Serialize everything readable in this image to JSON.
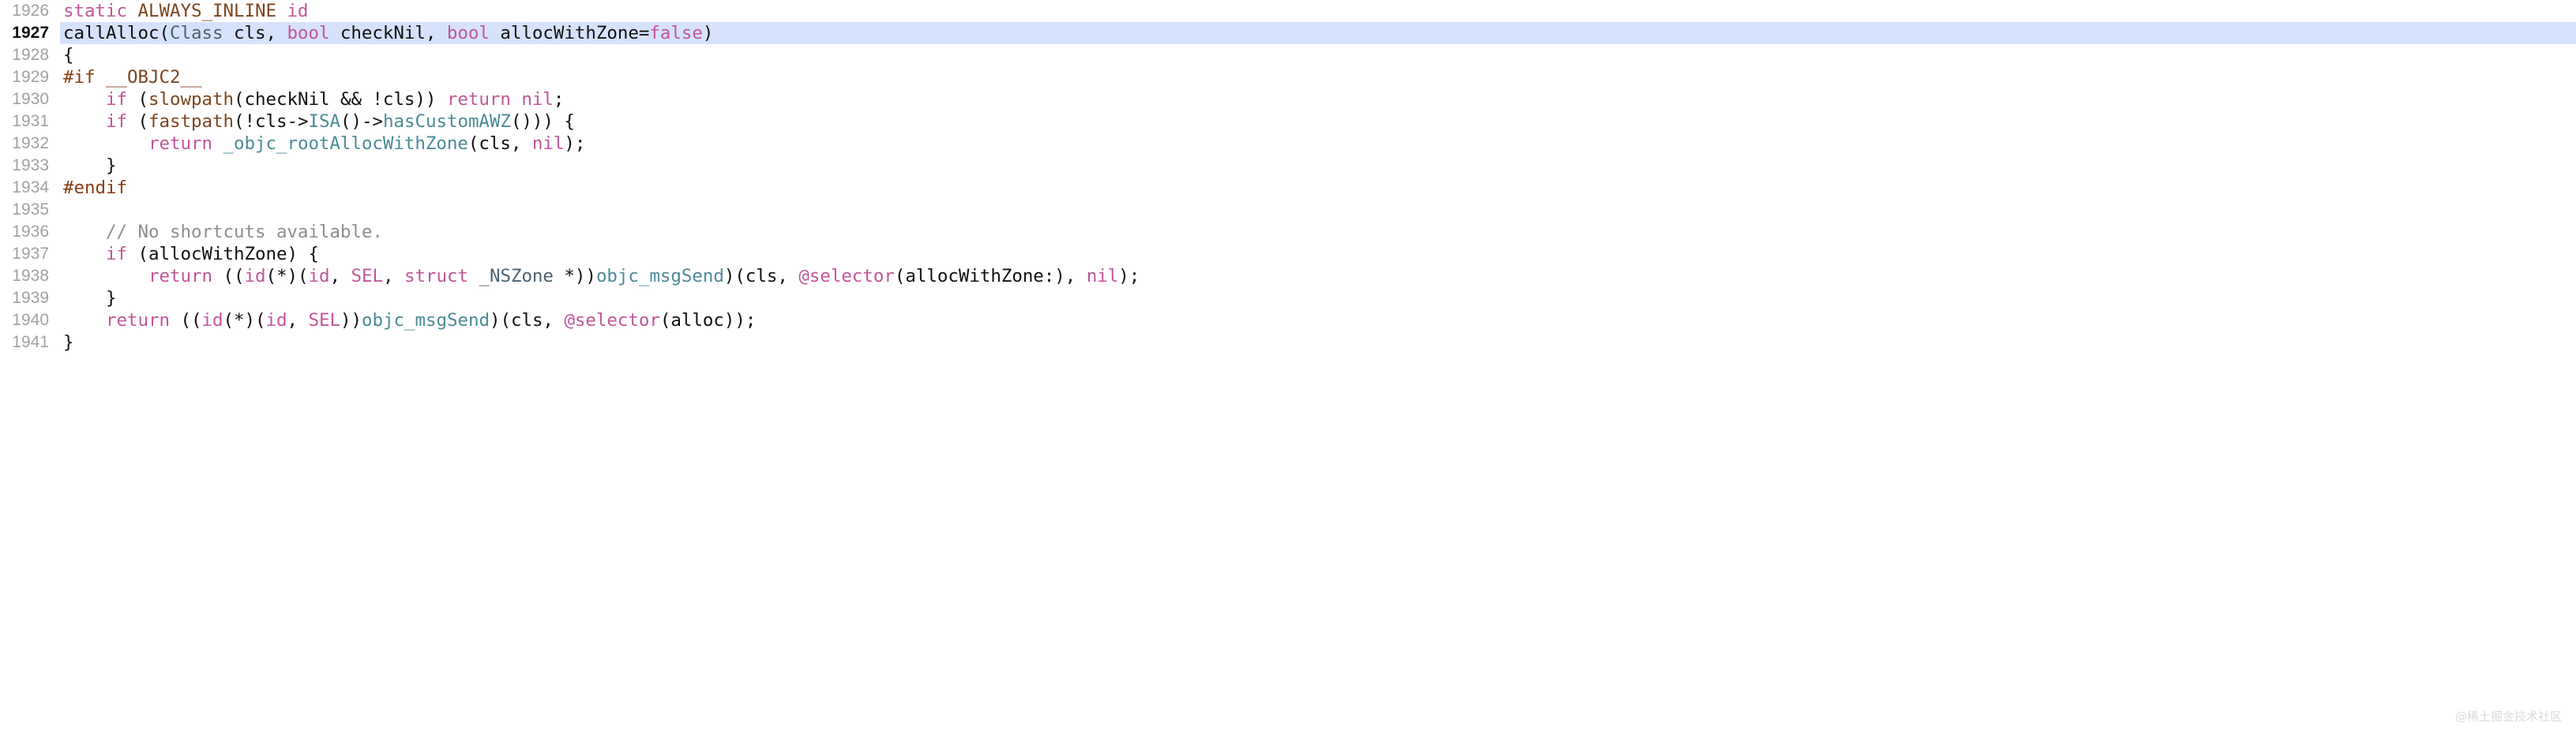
{
  "editor": {
    "background": "#ffffff",
    "gutter_color": "#a2a2a2",
    "highlight_color": "#d6e2fb",
    "highlighted_line": "1927",
    "language": "objective-c",
    "first_line": "1926",
    "last_line": "1941"
  },
  "colors": {
    "plain": "#111111",
    "keyword": "#c2569a",
    "macro": "#7c4521",
    "preproc": "#8a3b14",
    "type": "#4c6270",
    "function": "#3f84b5",
    "member": "#4b8b96",
    "comment": "#8e8e8e"
  },
  "watermark": {
    "text": "@稀土掘金技术社区"
  },
  "lines": [
    {
      "number": "1926",
      "highlighted": false,
      "text": "static ALWAYS_INLINE id",
      "tokens": [
        {
          "t": "static",
          "c": "keyword"
        },
        {
          "t": " ",
          "c": "plain"
        },
        {
          "t": "ALWAYS_INLINE",
          "c": "macro"
        },
        {
          "t": " ",
          "c": "plain"
        },
        {
          "t": "id",
          "c": "keyword"
        }
      ]
    },
    {
      "number": "1927",
      "highlighted": true,
      "text": "callAlloc(Class cls, bool checkNil, bool allocWithZone=false)",
      "tokens": [
        {
          "t": "callAlloc",
          "c": "function"
        },
        {
          "t": "(",
          "c": "plain"
        },
        {
          "t": "Class",
          "c": "type"
        },
        {
          "t": " cls, ",
          "c": "plain"
        },
        {
          "t": "bool",
          "c": "keyword"
        },
        {
          "t": " checkNil, ",
          "c": "plain"
        },
        {
          "t": "bool",
          "c": "keyword"
        },
        {
          "t": " allocWithZone=",
          "c": "plain"
        },
        {
          "t": "false",
          "c": "keyword"
        },
        {
          "t": ")",
          "c": "plain"
        }
      ]
    },
    {
      "number": "1928",
      "highlighted": false,
      "text": "{",
      "tokens": [
        {
          "t": "{",
          "c": "plain"
        }
      ]
    },
    {
      "number": "1929",
      "highlighted": false,
      "text": "#if __OBJC2__",
      "tokens": [
        {
          "t": "#if",
          "c": "preproc"
        },
        {
          "t": " ",
          "c": "plain"
        },
        {
          "t": "__OBJC2__",
          "c": "macro"
        }
      ]
    },
    {
      "number": "1930",
      "highlighted": false,
      "text": "    if (slowpath(checkNil && !cls)) return nil;",
      "tokens": [
        {
          "t": "    ",
          "c": "plain"
        },
        {
          "t": "if",
          "c": "keyword"
        },
        {
          "t": " (",
          "c": "plain"
        },
        {
          "t": "slowpath",
          "c": "macro"
        },
        {
          "t": "(checkNil && !cls)) ",
          "c": "plain"
        },
        {
          "t": "return",
          "c": "keyword"
        },
        {
          "t": " ",
          "c": "plain"
        },
        {
          "t": "nil",
          "c": "keyword"
        },
        {
          "t": ";",
          "c": "plain"
        }
      ]
    },
    {
      "number": "1931",
      "highlighted": false,
      "text": "    if (fastpath(!cls->ISA()->hasCustomAWZ())) {",
      "tokens": [
        {
          "t": "    ",
          "c": "plain"
        },
        {
          "t": "if",
          "c": "keyword"
        },
        {
          "t": " (",
          "c": "plain"
        },
        {
          "t": "fastpath",
          "c": "macro"
        },
        {
          "t": "(!cls->",
          "c": "plain"
        },
        {
          "t": "ISA",
          "c": "member"
        },
        {
          "t": "()->",
          "c": "plain"
        },
        {
          "t": "hasCustomAWZ",
          "c": "member"
        },
        {
          "t": "())) {",
          "c": "plain"
        }
      ]
    },
    {
      "number": "1932",
      "highlighted": false,
      "text": "        return _objc_rootAllocWithZone(cls, nil);",
      "tokens": [
        {
          "t": "        ",
          "c": "plain"
        },
        {
          "t": "return",
          "c": "keyword"
        },
        {
          "t": " ",
          "c": "plain"
        },
        {
          "t": "_objc_rootAllocWithZone",
          "c": "member"
        },
        {
          "t": "(cls, ",
          "c": "plain"
        },
        {
          "t": "nil",
          "c": "keyword"
        },
        {
          "t": ");",
          "c": "plain"
        }
      ]
    },
    {
      "number": "1933",
      "highlighted": false,
      "text": "    }",
      "tokens": [
        {
          "t": "    }",
          "c": "plain"
        }
      ]
    },
    {
      "number": "1934",
      "highlighted": false,
      "text": "#endif",
      "tokens": [
        {
          "t": "#endif",
          "c": "preproc"
        }
      ]
    },
    {
      "number": "1935",
      "highlighted": false,
      "text": "",
      "tokens": []
    },
    {
      "number": "1936",
      "highlighted": false,
      "text": "    // No shortcuts available.",
      "tokens": [
        {
          "t": "    ",
          "c": "plain"
        },
        {
          "t": "// No shortcuts available.",
          "c": "comment"
        }
      ]
    },
    {
      "number": "1937",
      "highlighted": false,
      "text": "    if (allocWithZone) {",
      "tokens": [
        {
          "t": "    ",
          "c": "plain"
        },
        {
          "t": "if",
          "c": "keyword"
        },
        {
          "t": " (allocWithZone) {",
          "c": "plain"
        }
      ]
    },
    {
      "number": "1938",
      "highlighted": false,
      "text": "        return ((id(*)(id, SEL, struct _NSZone *))objc_msgSend)(cls, @selector(allocWithZone:), nil);",
      "tokens": [
        {
          "t": "        ",
          "c": "plain"
        },
        {
          "t": "return",
          "c": "keyword"
        },
        {
          "t": " ((",
          "c": "plain"
        },
        {
          "t": "id",
          "c": "keyword"
        },
        {
          "t": "(*)(",
          "c": "plain"
        },
        {
          "t": "id",
          "c": "keyword"
        },
        {
          "t": ", ",
          "c": "plain"
        },
        {
          "t": "SEL",
          "c": "keyword"
        },
        {
          "t": ", ",
          "c": "plain"
        },
        {
          "t": "struct",
          "c": "keyword"
        },
        {
          "t": " ",
          "c": "plain"
        },
        {
          "t": "_NSZone",
          "c": "type"
        },
        {
          "t": " *))",
          "c": "plain"
        },
        {
          "t": "objc_msgSend",
          "c": "member"
        },
        {
          "t": ")(cls, ",
          "c": "plain"
        },
        {
          "t": "@selector",
          "c": "keyword"
        },
        {
          "t": "(allocWithZone:), ",
          "c": "plain"
        },
        {
          "t": "nil",
          "c": "keyword"
        },
        {
          "t": ");",
          "c": "plain"
        }
      ]
    },
    {
      "number": "1939",
      "highlighted": false,
      "text": "    }",
      "tokens": [
        {
          "t": "    }",
          "c": "plain"
        }
      ]
    },
    {
      "number": "1940",
      "highlighted": false,
      "text": "    return ((id(*)(id, SEL))objc_msgSend)(cls, @selector(alloc));",
      "tokens": [
        {
          "t": "    ",
          "c": "plain"
        },
        {
          "t": "return",
          "c": "keyword"
        },
        {
          "t": " ((",
          "c": "plain"
        },
        {
          "t": "id",
          "c": "keyword"
        },
        {
          "t": "(*)(",
          "c": "plain"
        },
        {
          "t": "id",
          "c": "keyword"
        },
        {
          "t": ", ",
          "c": "plain"
        },
        {
          "t": "SEL",
          "c": "keyword"
        },
        {
          "t": "))",
          "c": "plain"
        },
        {
          "t": "objc_msgSend",
          "c": "member"
        },
        {
          "t": ")(cls, ",
          "c": "plain"
        },
        {
          "t": "@selector",
          "c": "keyword"
        },
        {
          "t": "(alloc));",
          "c": "plain"
        }
      ]
    },
    {
      "number": "1941",
      "highlighted": false,
      "text": "}",
      "tokens": [
        {
          "t": "}",
          "c": "plain"
        }
      ]
    }
  ]
}
